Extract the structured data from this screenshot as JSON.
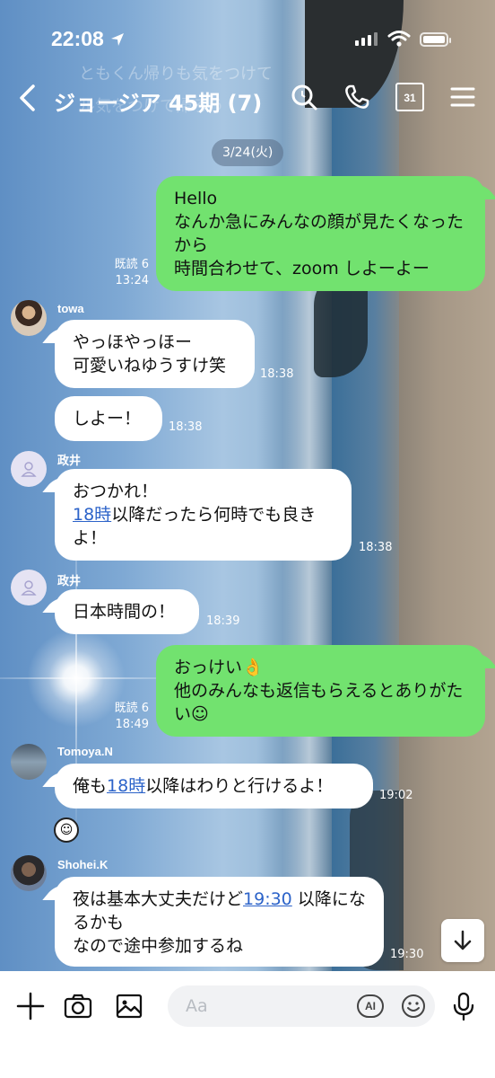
{
  "status_bar": {
    "time": "22:08"
  },
  "background_ghost_text": {
    "line1": "ともくん帰りも気をつけて",
    "line2": "ル気をつけて帰ろう"
  },
  "header": {
    "title": "ジョージア 45期 (7)",
    "calendar_day": "31"
  },
  "chat": {
    "date": "3/24(火)",
    "messages": [
      {
        "from": "me",
        "text": "Hello\nなんか急にみんなの顔が見たくなったから\n時間合わせて、zoom しよーよー",
        "read": "既読 6",
        "time": "13:24"
      },
      {
        "from": "towa",
        "sender": "towa",
        "text": "やっほやっほー\n可愛いねゆうすけ笑",
        "time": "18:38"
      },
      {
        "from": "towa",
        "text": "しよー！",
        "time": "18:38"
      },
      {
        "from": "masai",
        "sender": "政井",
        "line1": "おつかれ！",
        "link": "18時",
        "rest": "以降だったら何時でも良きよ！",
        "time": "18:38"
      },
      {
        "from": "masai",
        "sender": "政井",
        "text": "日本時間の！",
        "time": "18:39"
      },
      {
        "from": "me",
        "text": "おっけい👌\n他のみんなも返信もらえるとありがたい☺",
        "read": "既読 6",
        "time": "18:49"
      },
      {
        "from": "tomoya",
        "sender": "Tomoya.N",
        "pre": "俺も",
        "link": "18時",
        "rest": "以降はわりと行けるよ！",
        "time": "19:02"
      },
      {
        "from": "shohei",
        "sender": "Shohei.K",
        "pre": "夜は基本大丈夫だけど",
        "link": "19:30",
        "rest": " 以降になるかも\nなので途中参加するね",
        "time": "19:30"
      }
    ],
    "sticker": "☺"
  },
  "input": {
    "placeholder": "Aa",
    "ai_label": "AI"
  }
}
